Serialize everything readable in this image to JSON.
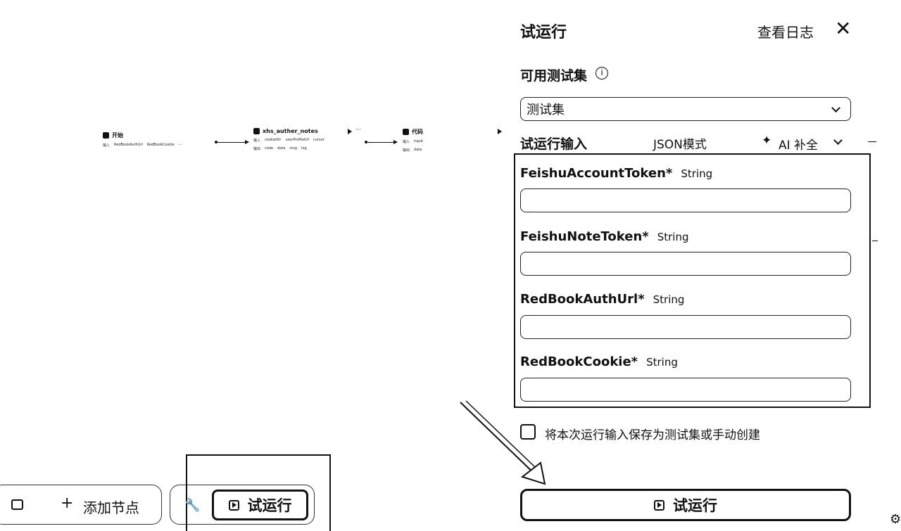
{
  "canvas": {
    "nodes": [
      {
        "title": "开始",
        "rows": [
          [
            "输入",
            "RedBookAuthUrl",
            "RedBookCookie"
          ]
        ]
      },
      {
        "title": "xhs_auther_notes",
        "rows": [
          [
            "输入",
            "cookieStr",
            "userProfileUrl",
            "cursor"
          ],
          [
            "输出",
            "code",
            "data",
            "msg",
            "log"
          ]
        ]
      },
      {
        "title": "代码",
        "rows": [
          [
            "输入",
            "input"
          ],
          [
            "输出",
            "data"
          ]
        ]
      }
    ]
  },
  "toolbar": {
    "add_node_label": "添加节点",
    "run_label": "试运行"
  },
  "panel": {
    "title": "试运行",
    "view_log_label": "查看日志",
    "testset_heading": "可用测试集",
    "testset_selected": "测试集",
    "input_heading": "试运行输入",
    "json_mode_label": "JSON模式",
    "ai_complete_label": "AI 补全",
    "fields": [
      {
        "name": "FeishuAccountToken*",
        "type": "String",
        "value": ""
      },
      {
        "name": "FeishuNoteToken*",
        "type": "String",
        "value": ""
      },
      {
        "name": "RedBookAuthUrl*",
        "type": "String",
        "value": ""
      },
      {
        "name": "RedBookCookie*",
        "type": "String",
        "value": ""
      }
    ],
    "save_checkbox_label": "将本次运行输入保存为测试集或手动创建",
    "save_checkbox_checked": false,
    "run_button_label": "试运行"
  },
  "icons": [
    "close-icon",
    "info-icon",
    "chevron-down-icon",
    "sparkle-icon",
    "play-icon",
    "plus-icon",
    "note-icon",
    "wrench-icon",
    "arrow-annotation"
  ]
}
